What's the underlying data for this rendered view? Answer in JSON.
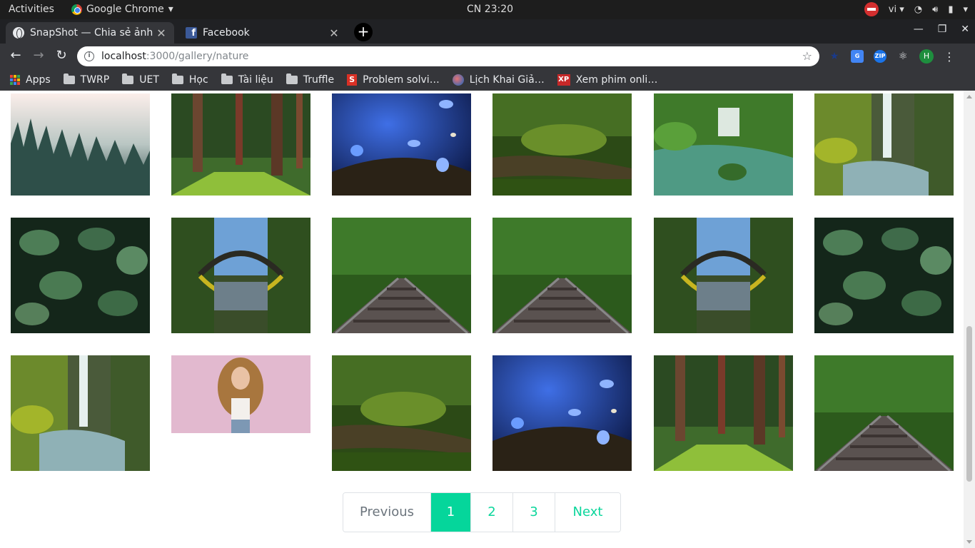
{
  "system": {
    "activities": "Activities",
    "app_name": "Google Chrome",
    "clock": "CN 23:20",
    "language": "vi"
  },
  "tabs": [
    {
      "title": "SnapShot — Chia sẻ ảnh",
      "active": true,
      "favicon": "globe-icon"
    },
    {
      "title": "Facebook",
      "active": false,
      "favicon": "facebook-icon"
    }
  ],
  "address": {
    "host": "localhost",
    "path": ":3000/gallery/nature"
  },
  "bookmarks": [
    "Apps",
    "TWRP",
    "UET",
    "Học",
    "Tài liệu",
    "Truffle",
    "Problem solvi…",
    "Lịch Khai Giả…",
    "Xem phim onli…"
  ],
  "extensions": [
    "star-extension-icon",
    "translate-extension-icon",
    "zip-extension-icon",
    "react-extension-icon"
  ],
  "profile_initial": "H",
  "gallery": {
    "category": "nature",
    "rows": [
      [
        "foggy-forest",
        "pine-forest-path",
        "blue-butterflies",
        "mossy-stream",
        "forest-waterfall",
        "tall-waterfall"
      ],
      [
        "green-leaves",
        "arch-bridge-reflection",
        "railway-tracks",
        "railway-tracks",
        "arch-bridge-reflection",
        "green-leaves"
      ],
      [
        "tall-waterfall",
        "woman-pink-background",
        "mossy-stream",
        "blue-butterflies",
        "pine-forest-path",
        "railway-tracks"
      ]
    ]
  },
  "pagination": {
    "previous": "Previous",
    "pages": [
      "1",
      "2",
      "3"
    ],
    "active_page": "1",
    "next": "Next"
  },
  "colors": {
    "accent": "#05d69b",
    "chrome_frame": "#202124",
    "chrome_toolbar": "#35363a"
  }
}
